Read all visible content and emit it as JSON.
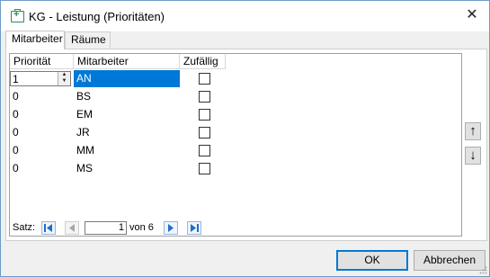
{
  "window": {
    "title": "KG - Leistung (Prioritäten)",
    "close_glyph": "✕"
  },
  "tabs": [
    {
      "label": "Mitarbeiter",
      "active": true
    },
    {
      "label": "Räume",
      "active": false
    }
  ],
  "grid": {
    "columns": [
      "Priorität",
      "Mitarbeiter",
      "Zufällig"
    ],
    "rows": [
      {
        "priority": "1",
        "name": "AN",
        "random": false,
        "selected": true
      },
      {
        "priority": "0",
        "name": "BS",
        "random": false,
        "selected": false
      },
      {
        "priority": "0",
        "name": "EM",
        "random": false,
        "selected": false
      },
      {
        "priority": "0",
        "name": "JR",
        "random": false,
        "selected": false
      },
      {
        "priority": "0",
        "name": "MM",
        "random": false,
        "selected": false
      },
      {
        "priority": "0",
        "name": "MS",
        "random": false,
        "selected": false
      }
    ]
  },
  "navigator": {
    "label": "Satz:",
    "current": "1",
    "of_text": "von 6"
  },
  "side_buttons": {
    "up": "↑",
    "down": "↓"
  },
  "footer": {
    "ok": "OK",
    "cancel": "Abbrechen"
  },
  "colors": {
    "selection": "#0078d7",
    "nav_accent": "#1f6fc5"
  }
}
